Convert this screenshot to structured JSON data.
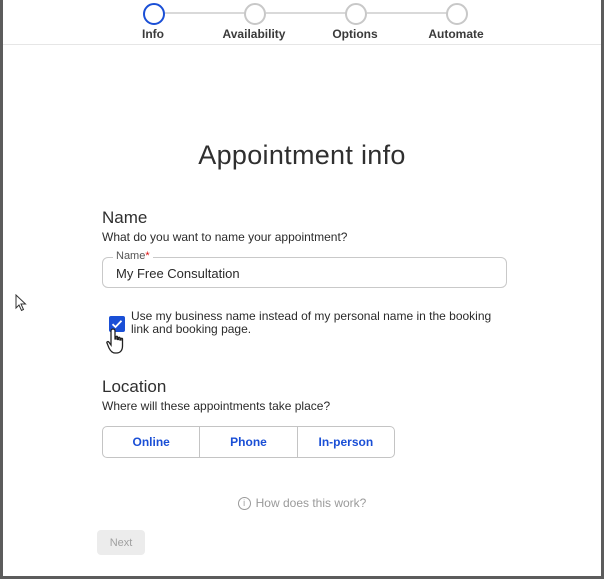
{
  "stepper": {
    "steps": [
      {
        "label": "Info",
        "active": true
      },
      {
        "label": "Availability",
        "active": false
      },
      {
        "label": "Options",
        "active": false
      },
      {
        "label": "Automate",
        "active": false
      }
    ]
  },
  "page": {
    "title": "Appointment info"
  },
  "name_section": {
    "heading": "Name",
    "subheading": "What do you want to name your appointment?",
    "field_label": "Name",
    "required_mark": "*",
    "field_value": "My Free Consultation",
    "checkbox_checked": true,
    "checkbox_text": "Use my business name instead of my personal name in the booking link and booking page."
  },
  "location_section": {
    "heading": "Location",
    "subheading": "Where will these appointments take place?",
    "options": [
      "Online",
      "Phone",
      "In-person"
    ]
  },
  "help": {
    "icon": "info-icon",
    "text": "How does this work?"
  },
  "actions": {
    "next_label": "Next"
  },
  "colors": {
    "accent": "#1a4fd6",
    "required": "#d11111"
  }
}
